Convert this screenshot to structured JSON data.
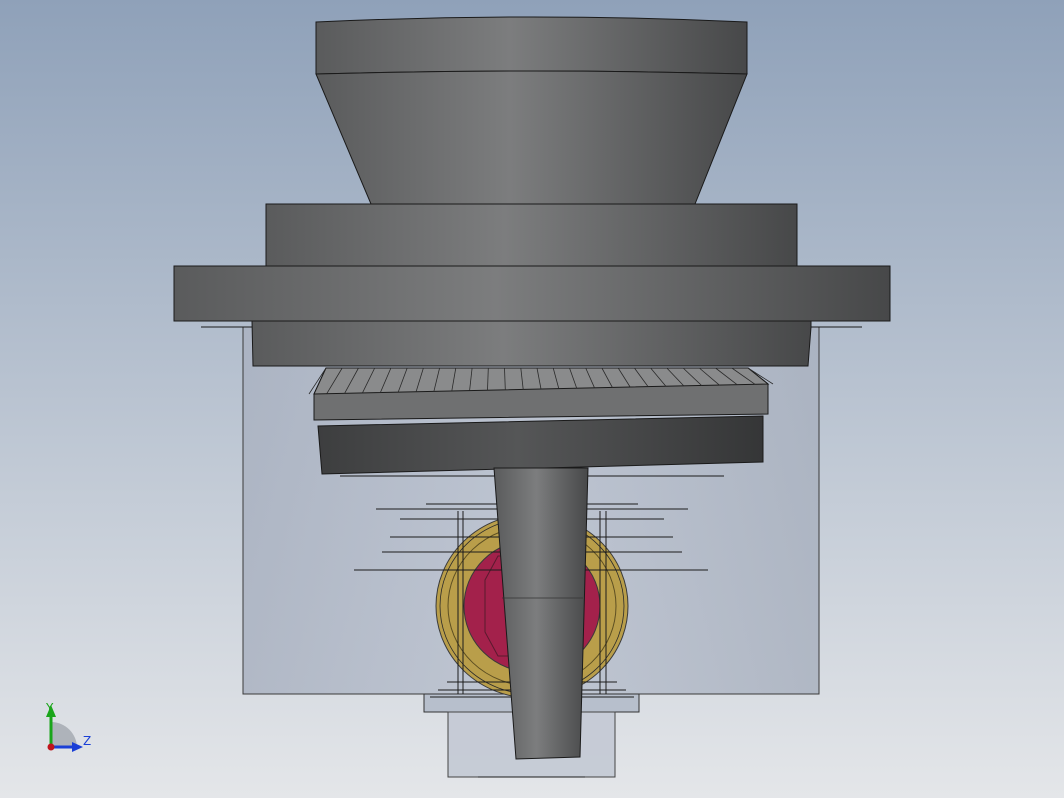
{
  "viewport": {
    "background_top": "#8fa1b9",
    "background_bottom": "#e4e6e9"
  },
  "triad": {
    "y_label": "Y",
    "z_label": "Z",
    "y_color": "#1aa51a",
    "z_color": "#1a3fd6",
    "origin_color": "#c0141c"
  },
  "model": {
    "part_color": "#6a6b6c",
    "housing_color": "#b4bccb",
    "bearing_outer_color": "#b99e4a",
    "bearing_inner_color": "#a3214b",
    "edge_color": "#1a1a1a"
  }
}
